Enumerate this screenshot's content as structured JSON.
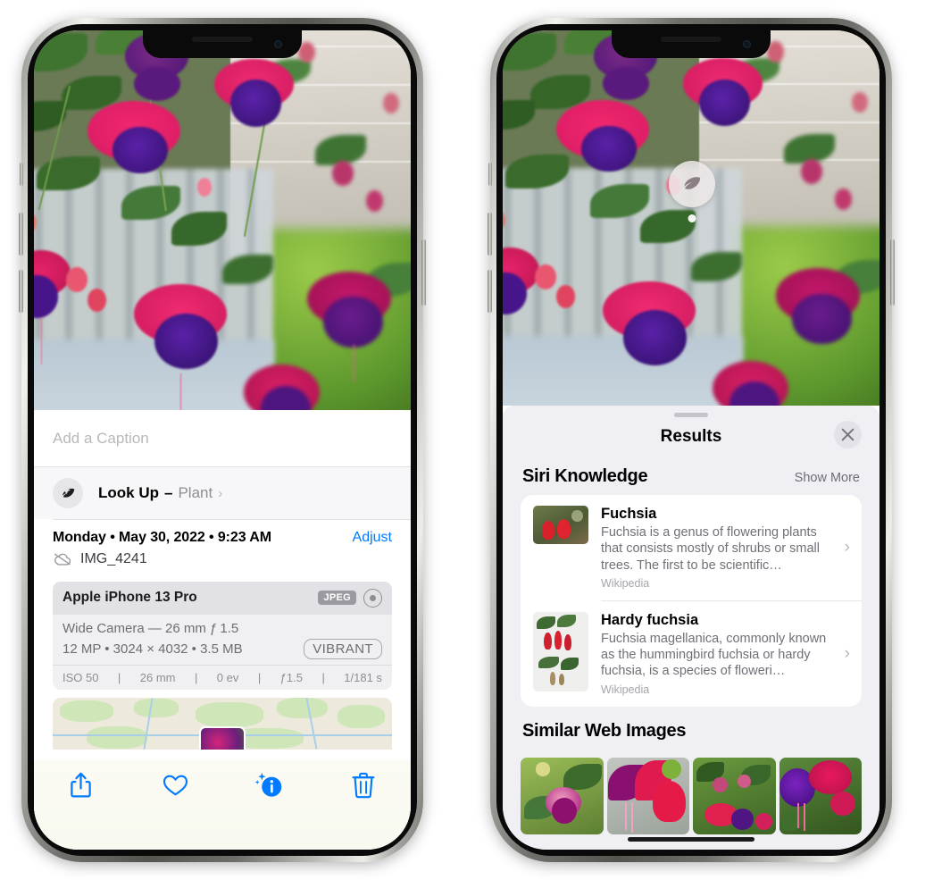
{
  "left_phone": {
    "name": "photos-detail-screen",
    "caption_field": {
      "placeholder": "Add a Caption",
      "value": ""
    },
    "look_up": {
      "label": "Look Up",
      "dash": "–",
      "subject": "Plant",
      "chevron": "›",
      "icon": "leaf-icon"
    },
    "info": {
      "date_line": "Monday • May 30, 2022 • 9:23 AM",
      "adjust_label": "Adjust",
      "filename": "IMG_4241",
      "cloud_icon": "icloud-slash-icon"
    },
    "camera_card": {
      "device": "Apple iPhone 13 Pro",
      "format_badge": "JPEG",
      "raw_icon": "raw-circle-icon",
      "lens_line": "Wide Camera — 26 mm ƒ 1.5",
      "size_line": "12 MP • 3024 × 4032 • 3.5 MB",
      "style_badge": "VIBRANT",
      "exif": [
        "ISO 50",
        "26 mm",
        "0 ev",
        "ƒ1.5",
        "1/181 s"
      ],
      "exif_separator": "|"
    },
    "toolbar": [
      {
        "name": "share-button",
        "icon": "share-icon"
      },
      {
        "name": "favorite-button",
        "icon": "heart-icon"
      },
      {
        "name": "info-button",
        "icon": "info-sparkle-icon"
      },
      {
        "name": "delete-button",
        "icon": "trash-icon"
      }
    ],
    "accent_color": "#007aff"
  },
  "right_phone": {
    "name": "visual-look-up-results-screen",
    "vlu_badge": {
      "icon": "leaf-icon",
      "label": ""
    },
    "sheet": {
      "grabber": "drag-handle",
      "title": "Results",
      "close_label": "✕"
    },
    "siri_knowledge": {
      "section_title": "Siri Knowledge",
      "show_more": "Show More",
      "items": [
        {
          "title": "Fuchsia",
          "description": "Fuchsia is a genus of flowering plants that consists mostly of shrubs or small trees. The first to be scientific…",
          "source": "Wikipedia",
          "chevron": "›"
        },
        {
          "title": "Hardy fuchsia",
          "description": "Fuchsia magellanica, commonly known as the hummingbird fuchsia or hardy fuchsia, is a species of floweri…",
          "source": "Wikipedia",
          "chevron": "›"
        }
      ]
    },
    "similar_web_images": {
      "section_title": "Similar Web Images",
      "count": 4
    },
    "panel_color": "#f0eff4"
  }
}
